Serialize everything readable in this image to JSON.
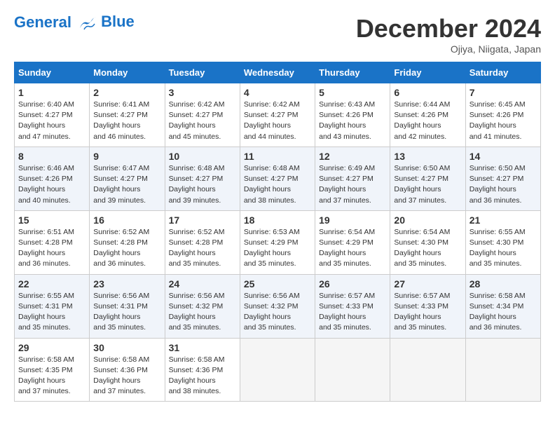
{
  "header": {
    "logo_line1": "General",
    "logo_line2": "Blue",
    "month_title": "December 2024",
    "location": "Ojiya, Niigata, Japan"
  },
  "days_of_week": [
    "Sunday",
    "Monday",
    "Tuesday",
    "Wednesday",
    "Thursday",
    "Friday",
    "Saturday"
  ],
  "weeks": [
    [
      {
        "day": 1,
        "sunrise": "6:40 AM",
        "sunset": "4:27 PM",
        "daylight": "9 hours and 47 minutes."
      },
      {
        "day": 2,
        "sunrise": "6:41 AM",
        "sunset": "4:27 PM",
        "daylight": "9 hours and 46 minutes."
      },
      {
        "day": 3,
        "sunrise": "6:42 AM",
        "sunset": "4:27 PM",
        "daylight": "9 hours and 45 minutes."
      },
      {
        "day": 4,
        "sunrise": "6:42 AM",
        "sunset": "4:27 PM",
        "daylight": "9 hours and 44 minutes."
      },
      {
        "day": 5,
        "sunrise": "6:43 AM",
        "sunset": "4:26 PM",
        "daylight": "9 hours and 43 minutes."
      },
      {
        "day": 6,
        "sunrise": "6:44 AM",
        "sunset": "4:26 PM",
        "daylight": "9 hours and 42 minutes."
      },
      {
        "day": 7,
        "sunrise": "6:45 AM",
        "sunset": "4:26 PM",
        "daylight": "9 hours and 41 minutes."
      }
    ],
    [
      {
        "day": 8,
        "sunrise": "6:46 AM",
        "sunset": "4:26 PM",
        "daylight": "9 hours and 40 minutes."
      },
      {
        "day": 9,
        "sunrise": "6:47 AM",
        "sunset": "4:27 PM",
        "daylight": "9 hours and 39 minutes."
      },
      {
        "day": 10,
        "sunrise": "6:48 AM",
        "sunset": "4:27 PM",
        "daylight": "9 hours and 39 minutes."
      },
      {
        "day": 11,
        "sunrise": "6:48 AM",
        "sunset": "4:27 PM",
        "daylight": "9 hours and 38 minutes."
      },
      {
        "day": 12,
        "sunrise": "6:49 AM",
        "sunset": "4:27 PM",
        "daylight": "9 hours and 37 minutes."
      },
      {
        "day": 13,
        "sunrise": "6:50 AM",
        "sunset": "4:27 PM",
        "daylight": "9 hours and 37 minutes."
      },
      {
        "day": 14,
        "sunrise": "6:50 AM",
        "sunset": "4:27 PM",
        "daylight": "9 hours and 36 minutes."
      }
    ],
    [
      {
        "day": 15,
        "sunrise": "6:51 AM",
        "sunset": "4:28 PM",
        "daylight": "9 hours and 36 minutes."
      },
      {
        "day": 16,
        "sunrise": "6:52 AM",
        "sunset": "4:28 PM",
        "daylight": "9 hours and 36 minutes."
      },
      {
        "day": 17,
        "sunrise": "6:52 AM",
        "sunset": "4:28 PM",
        "daylight": "9 hours and 35 minutes."
      },
      {
        "day": 18,
        "sunrise": "6:53 AM",
        "sunset": "4:29 PM",
        "daylight": "9 hours and 35 minutes."
      },
      {
        "day": 19,
        "sunrise": "6:54 AM",
        "sunset": "4:29 PM",
        "daylight": "9 hours and 35 minutes."
      },
      {
        "day": 20,
        "sunrise": "6:54 AM",
        "sunset": "4:30 PM",
        "daylight": "9 hours and 35 minutes."
      },
      {
        "day": 21,
        "sunrise": "6:55 AM",
        "sunset": "4:30 PM",
        "daylight": "9 hours and 35 minutes."
      }
    ],
    [
      {
        "day": 22,
        "sunrise": "6:55 AM",
        "sunset": "4:31 PM",
        "daylight": "9 hours and 35 minutes."
      },
      {
        "day": 23,
        "sunrise": "6:56 AM",
        "sunset": "4:31 PM",
        "daylight": "9 hours and 35 minutes."
      },
      {
        "day": 24,
        "sunrise": "6:56 AM",
        "sunset": "4:32 PM",
        "daylight": "9 hours and 35 minutes."
      },
      {
        "day": 25,
        "sunrise": "6:56 AM",
        "sunset": "4:32 PM",
        "daylight": "9 hours and 35 minutes."
      },
      {
        "day": 26,
        "sunrise": "6:57 AM",
        "sunset": "4:33 PM",
        "daylight": "9 hours and 35 minutes."
      },
      {
        "day": 27,
        "sunrise": "6:57 AM",
        "sunset": "4:33 PM",
        "daylight": "9 hours and 35 minutes."
      },
      {
        "day": 28,
        "sunrise": "6:58 AM",
        "sunset": "4:34 PM",
        "daylight": "9 hours and 36 minutes."
      }
    ],
    [
      {
        "day": 29,
        "sunrise": "6:58 AM",
        "sunset": "4:35 PM",
        "daylight": "9 hours and 37 minutes."
      },
      {
        "day": 30,
        "sunrise": "6:58 AM",
        "sunset": "4:36 PM",
        "daylight": "9 hours and 37 minutes."
      },
      {
        "day": 31,
        "sunrise": "6:58 AM",
        "sunset": "4:36 PM",
        "daylight": "9 hours and 38 minutes."
      },
      null,
      null,
      null,
      null
    ]
  ]
}
